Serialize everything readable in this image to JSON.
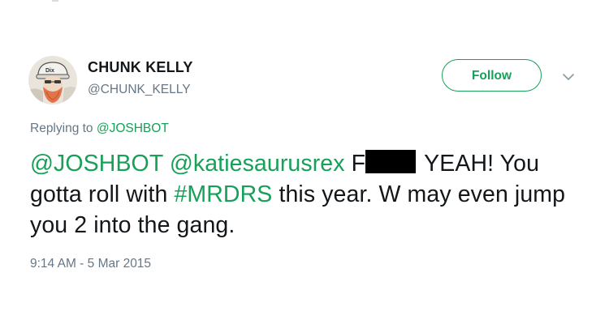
{
  "user": {
    "display_name": "CHUNK KELLY",
    "handle": "@CHUNK_KELLY",
    "avatar_icon": "avatar-photo-icon"
  },
  "follow_label": "Follow",
  "more_icon": "chevron-down-icon",
  "reply": {
    "prefix": "Replying to",
    "mention": "@JOSHBOT"
  },
  "tweet": {
    "mention_1": "@JOSHBOT",
    "mention_2": "@katiesaurusrex",
    "text_1": "F",
    "text_2": "YEAH! You gotta roll with",
    "hashtag": "#MRDRS",
    "text_3": "this year. W may even jump you 2 into the gang."
  },
  "timestamp": "9:14 AM - 5 Mar 2015",
  "colors": {
    "accent": "#17a058",
    "text": "#14171a",
    "muted": "#657786",
    "redaction": "#000000"
  }
}
